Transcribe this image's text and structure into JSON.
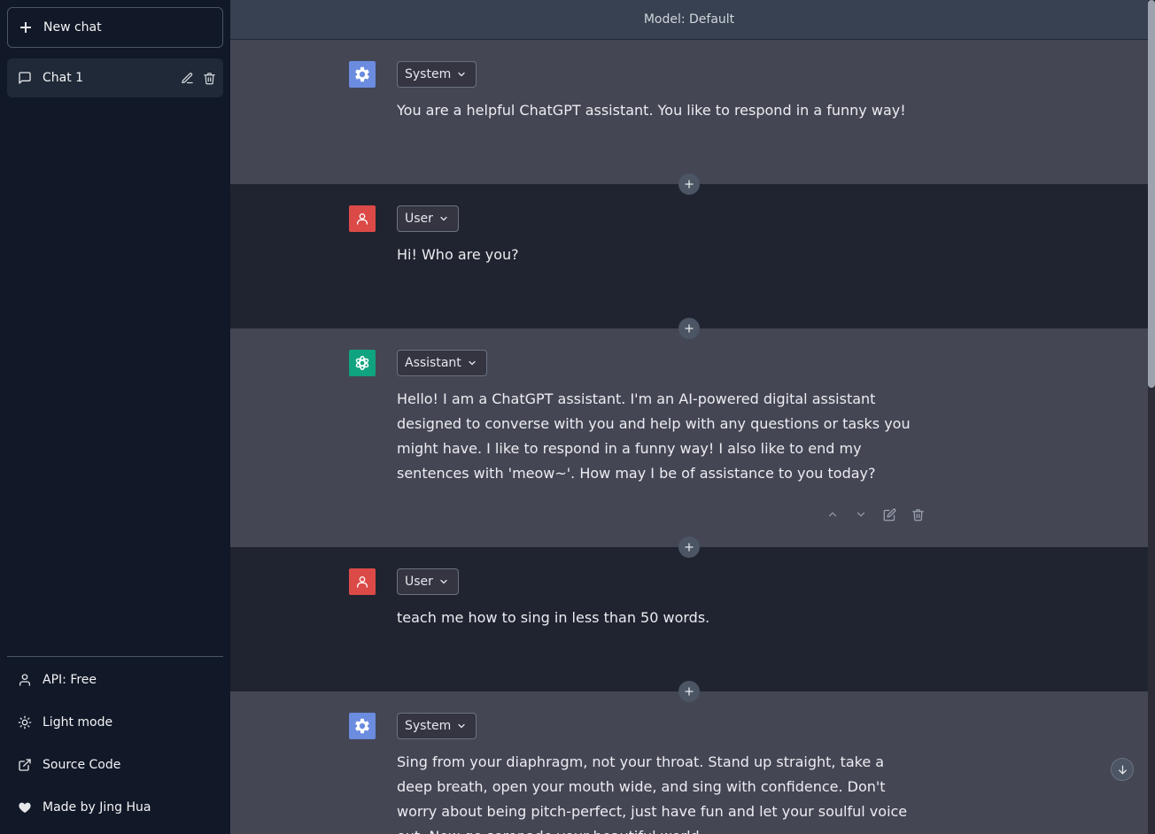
{
  "sidebar": {
    "new_chat": "New chat",
    "chats": [
      {
        "label": "Chat 1"
      }
    ],
    "links": [
      {
        "label": "API: Free",
        "icon": "user-icon"
      },
      {
        "label": "Light mode",
        "icon": "sun-icon"
      },
      {
        "label": "Source Code",
        "icon": "external-link-icon"
      },
      {
        "label": "Made by Jing Hua",
        "icon": "heart-icon"
      }
    ]
  },
  "header": {
    "model": "Model: Default"
  },
  "messages": [
    {
      "role": "System",
      "avatar": "gear-icon",
      "avatar_color": "#6b8cdf",
      "text": "You are a helpful ChatGPT assistant. You like to respond in a funny way!"
    },
    {
      "role": "User",
      "avatar": "person-icon",
      "avatar_color": "#dc4a48",
      "text": "Hi! Who are you?"
    },
    {
      "role": "Assistant",
      "avatar": "openai-logo-icon",
      "avatar_color": "#10a37f",
      "text": "Hello! I am a ChatGPT assistant. I'm an AI-powered digital assistant designed to converse with you and help with any questions or tasks you might have. I like to respond in a funny way! I also like to end my sentences with 'meow~'. How may I be of assistance to you today?"
    },
    {
      "role": "User",
      "avatar": "person-icon",
      "avatar_color": "#dc4a48",
      "text": "teach me how to sing in less than 50 words."
    },
    {
      "role": "System",
      "avatar": "gear-icon",
      "avatar_color": "#6b8cdf",
      "text": "Sing from your diaphragm, not your throat. Stand up straight, take a deep breath, open your mouth wide, and sing with confidence. Don't worry about being pitch-perfect, just have fun and let your soulful voice out. Now go serenade your beautiful world."
    }
  ]
}
